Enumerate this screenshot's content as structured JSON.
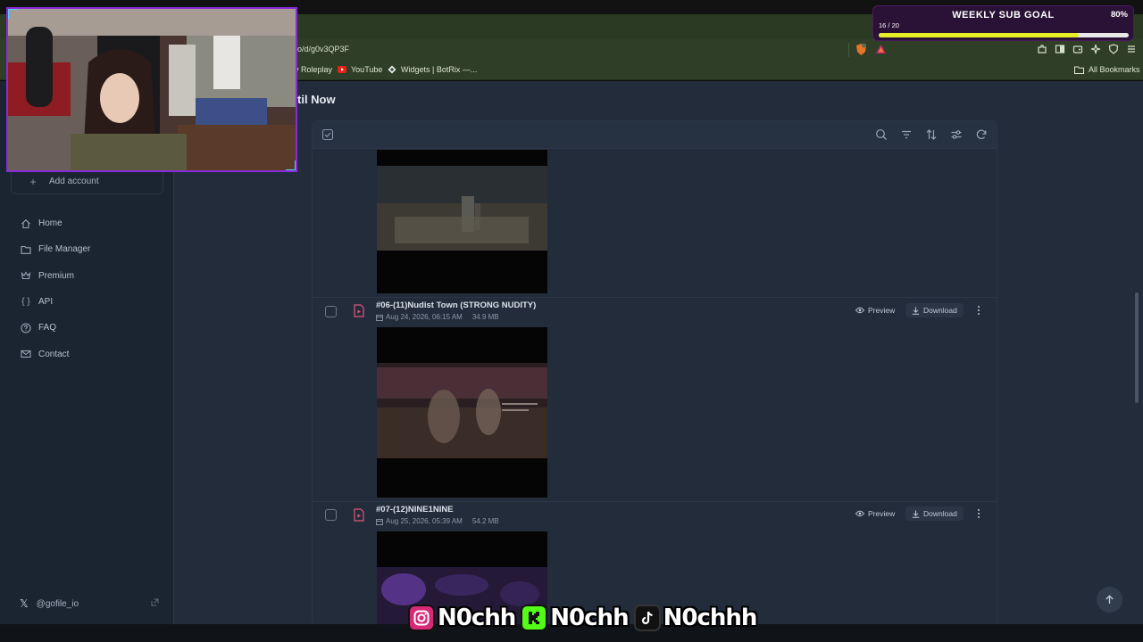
{
  "browser": {
    "url": "o/d/g0v3QP3F",
    "bookmarks": [
      {
        "label": "y Roleplay",
        "icon": "bookmark-icon"
      },
      {
        "label": "YouTube",
        "icon": "youtube-icon"
      },
      {
        "label": "Widgets | BotRix —...",
        "icon": "botrix-icon"
      }
    ],
    "all_bookmarks": "All Bookmarks"
  },
  "page": {
    "title": "til Now"
  },
  "sidebar": {
    "add_account": "Add account",
    "items": [
      {
        "label": "Home",
        "icon": "home-icon"
      },
      {
        "label": "File Manager",
        "icon": "folder-icon"
      },
      {
        "label": "Premium",
        "icon": "crown-icon"
      },
      {
        "label": "API",
        "icon": "braces-icon"
      },
      {
        "label": "FAQ",
        "icon": "question-icon"
      },
      {
        "label": "Contact",
        "icon": "mail-icon"
      }
    ],
    "social": "@gofile_io"
  },
  "files": [
    {
      "name": "#06-(11)Nudist Town (STRONG NUDITY)",
      "date": "Aug 24, 2026, 06:15 AM",
      "size": "34.9 MB",
      "preview_label": "Preview",
      "download_label": "Download"
    },
    {
      "name": "#07-(12)NINE1NINE",
      "date": "Aug 25, 2026, 05:39 AM",
      "size": "54.2 MB",
      "preview_label": "Preview",
      "download_label": "Download"
    }
  ],
  "overlay": {
    "sub_goal": {
      "title": "WEEKLY SUB GOAL",
      "percent_label": "80%",
      "count": "16 / 20",
      "progress": 0.8
    },
    "handles": [
      {
        "platform": "instagram-icon",
        "name": "N0chh",
        "color": "#d62976"
      },
      {
        "platform": "kick-icon",
        "name": "N0chh",
        "color": "#53fc18"
      },
      {
        "platform": "tiktok-icon",
        "name": "N0chhh",
        "color": "#111111"
      }
    ]
  }
}
